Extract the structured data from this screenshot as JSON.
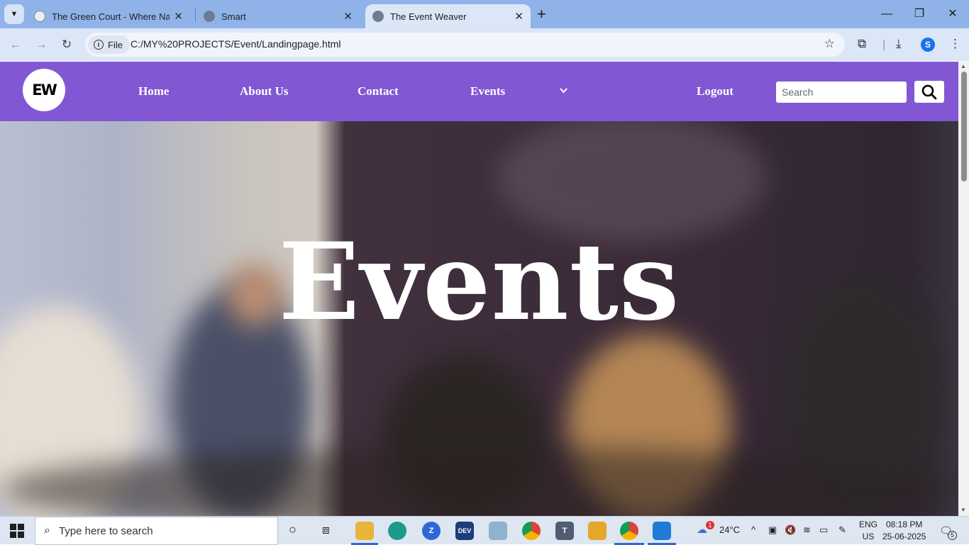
{
  "browser": {
    "tabs": [
      {
        "title": "The Green Court - Where Natur",
        "active": false
      },
      {
        "title": "Smart",
        "active": false
      },
      {
        "title": "The Event Weaver",
        "active": true
      }
    ],
    "file_chip": "File",
    "url": "C:/MY%20PROJECTS/Event/Landingpage.html",
    "profile_initial": "S"
  },
  "site": {
    "logo_text": "EW",
    "nav": {
      "home": "Home",
      "about": "About Us",
      "contact": "Contact",
      "events": "Events",
      "logout": "Logout"
    },
    "search": {
      "placeholder": "Search"
    },
    "hero_title": "Events",
    "accent_color": "#8157d4"
  },
  "taskbar": {
    "search_placeholder": "Type here to search",
    "weather_temp": "24°C",
    "weather_badge": "1",
    "lang_line1": "ENG",
    "lang_line2": "US",
    "time": "08:18 PM",
    "date": "25-06-2025",
    "notification_count": "5"
  }
}
